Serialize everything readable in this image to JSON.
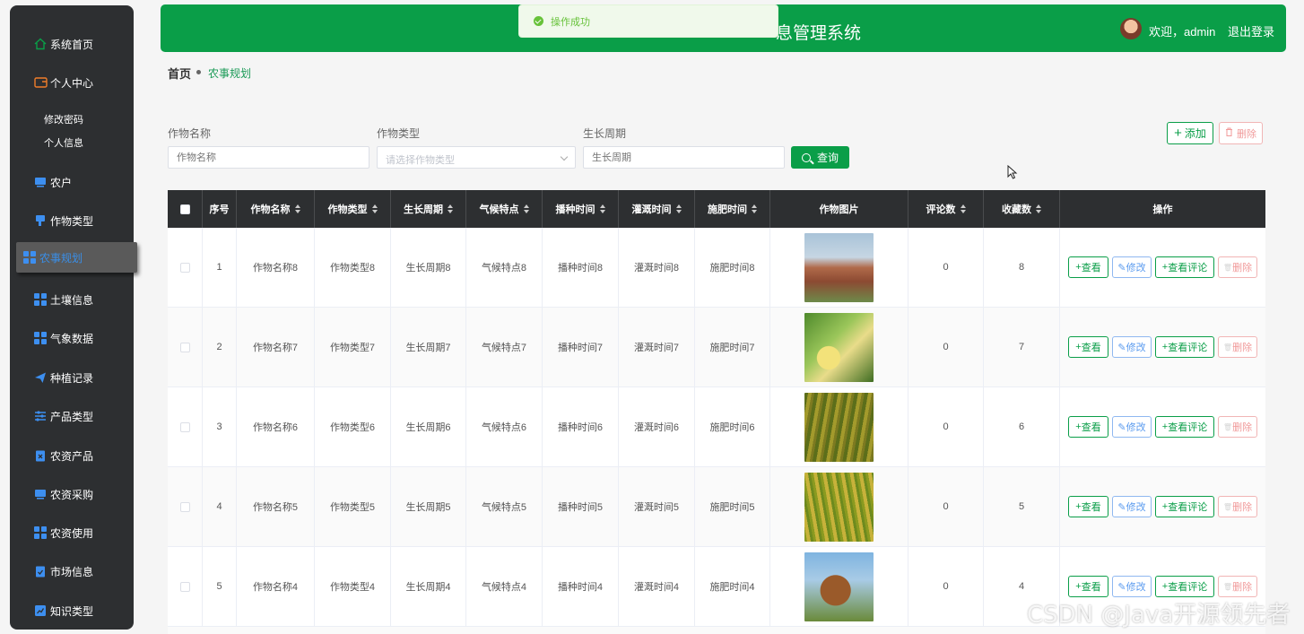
{
  "sidebar": {
    "items": [
      {
        "label": "系统首页",
        "icon": "home-icon"
      },
      {
        "label": "个人中心",
        "icon": "wallet-icon"
      },
      {
        "label": "农户",
        "icon": "monitor-icon"
      },
      {
        "label": "作物类型",
        "icon": "flag-icon"
      },
      {
        "label": "农事规划",
        "icon": "grid-icon"
      },
      {
        "label": "土壤信息",
        "icon": "grid-icon"
      },
      {
        "label": "气象数据",
        "icon": "grid-icon"
      },
      {
        "label": "种植记录",
        "icon": "send-icon"
      },
      {
        "label": "产品类型",
        "icon": "sliders-icon"
      },
      {
        "label": "农资产品",
        "icon": "clipboard-x-icon"
      },
      {
        "label": "农资采购",
        "icon": "monitor-icon"
      },
      {
        "label": "农资使用",
        "icon": "grid-icon"
      },
      {
        "label": "市场信息",
        "icon": "clipboard-check-icon"
      },
      {
        "label": "知识类型",
        "icon": "chart-icon"
      }
    ],
    "sub_items": [
      "修改密码",
      "个人信息"
    ]
  },
  "header": {
    "title": "息管理系统",
    "welcome": "欢迎，admin",
    "logout": "退出登录"
  },
  "toast": {
    "message": "操作成功"
  },
  "breadcrumb": {
    "home": "首页",
    "current": "农事规划"
  },
  "search": {
    "name_label": "作物名称",
    "name_placeholder": "作物名称",
    "type_label": "作物类型",
    "type_placeholder": "请选择作物类型",
    "cycle_label": "生长周期",
    "cycle_placeholder": "生长周期",
    "query_button": "查询",
    "add_button": "添加",
    "delete_button": "删除"
  },
  "table": {
    "headers": [
      "序号",
      "作物名称",
      "作物类型",
      "生长周期",
      "气候特点",
      "播种时间",
      "灌溉时间",
      "施肥时间",
      "作物图片",
      "评论数",
      "收藏数",
      "操作"
    ],
    "actions": {
      "view": "查看",
      "edit": "修改",
      "comments": "查看评论",
      "delete": "删除"
    },
    "rows": [
      {
        "index": "1",
        "name": "作物名称8",
        "type": "作物类型8",
        "cycle": "生长周期8",
        "climate": "气候特点8",
        "sow": "播种时间8",
        "irrigate": "灌溉时间8",
        "fertilize": "施肥时间8",
        "comments": "0",
        "favorites": "8",
        "image": "sorghum-sky"
      },
      {
        "index": "2",
        "name": "作物名称7",
        "type": "作物类型7",
        "cycle": "生长周期7",
        "climate": "气候特点7",
        "sow": "播种时间7",
        "irrigate": "灌溉时间7",
        "fertilize": "施肥时间7",
        "comments": "0",
        "favorites": "7",
        "image": "corn-cob"
      },
      {
        "index": "3",
        "name": "作物名称6",
        "type": "作物类型6",
        "cycle": "生长周期6",
        "climate": "气候特点6",
        "sow": "播种时间6",
        "irrigate": "灌溉时间6",
        "fertilize": "施肥时间6",
        "comments": "0",
        "favorites": "6",
        "image": "millet-field"
      },
      {
        "index": "4",
        "name": "作物名称5",
        "type": "作物类型5",
        "cycle": "生长周期5",
        "climate": "气候特点5",
        "sow": "播种时间5",
        "irrigate": "灌溉时间5",
        "fertilize": "施肥时间5",
        "comments": "0",
        "favorites": "5",
        "image": "rice-field"
      },
      {
        "index": "5",
        "name": "作物名称4",
        "type": "作物类型4",
        "cycle": "生长周期4",
        "climate": "气候特点4",
        "sow": "播种时间4",
        "irrigate": "灌溉时间4",
        "fertilize": "施肥时间4",
        "comments": "0",
        "favorites": "4",
        "image": "sorghum-head"
      }
    ]
  },
  "watermark": "CSDN @Java开源领先者",
  "colors": {
    "primary": "#0a9e48",
    "sidebar": "#2d2f31",
    "active_text": "#3a8ee6",
    "danger": "#f19a9a"
  }
}
